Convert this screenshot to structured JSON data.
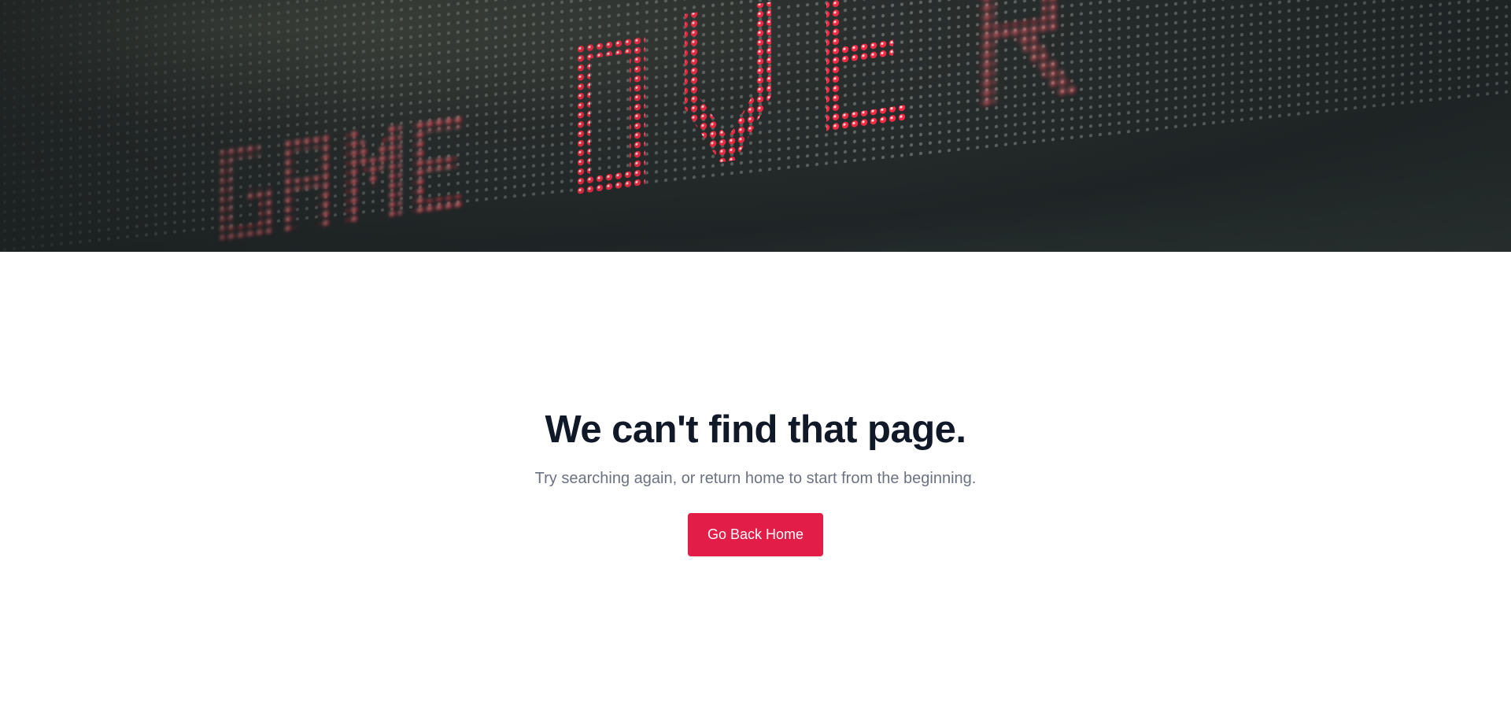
{
  "hero": {
    "display_text": "GAME OVER"
  },
  "main": {
    "title": "We can't find that page.",
    "subtitle": "Try searching again, or return home to start from the beginning.",
    "button_label": "Go Back Home"
  },
  "colors": {
    "accent": "#e11d48",
    "title": "#111827",
    "subtitle": "#6b7280",
    "led": "#f5213f"
  }
}
